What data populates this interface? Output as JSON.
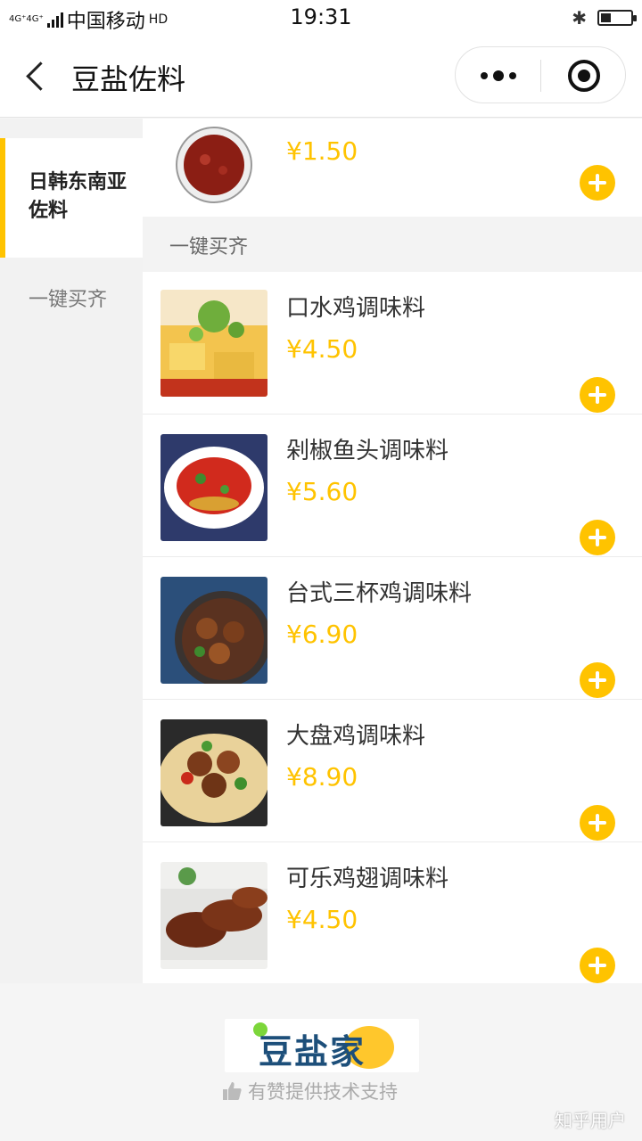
{
  "status_bar": {
    "network": "4G⁺4G⁺",
    "carrier": "中国移动",
    "hd": "HD",
    "time": "19:31",
    "battery_level": 0.35,
    "icons": [
      "signal-icon",
      "bluetooth-icon",
      "battery-icon"
    ]
  },
  "nav": {
    "title": "豆盐佐料",
    "icons": [
      "back-arrow-icon",
      "more-dots-icon",
      "close-target-icon"
    ]
  },
  "categories": [
    {
      "label": "日韩东南亚佐料",
      "active": true
    },
    {
      "label": "一键买齐",
      "active": false
    }
  ],
  "products_partial": {
    "price": "¥1.50"
  },
  "section": {
    "label": "一键买齐"
  },
  "products": [
    {
      "name": "口水鸡调味料",
      "price": "¥4.50"
    },
    {
      "name": "剁椒鱼头调味料",
      "price": "¥5.60"
    },
    {
      "name": "台式三杯鸡调味料",
      "price": "¥6.90"
    },
    {
      "name": "大盘鸡调味料",
      "price": "¥8.90"
    },
    {
      "name": "可乐鸡翅调味料",
      "price": "¥4.50"
    }
  ],
  "footer": {
    "brand": "豆盐家",
    "powered_by": "有赞提供技术支持",
    "watermark": "知乎用户"
  },
  "colors": {
    "accent": "#ffc300",
    "price": "#ffc300",
    "brand_text": "#1d4f7a"
  }
}
